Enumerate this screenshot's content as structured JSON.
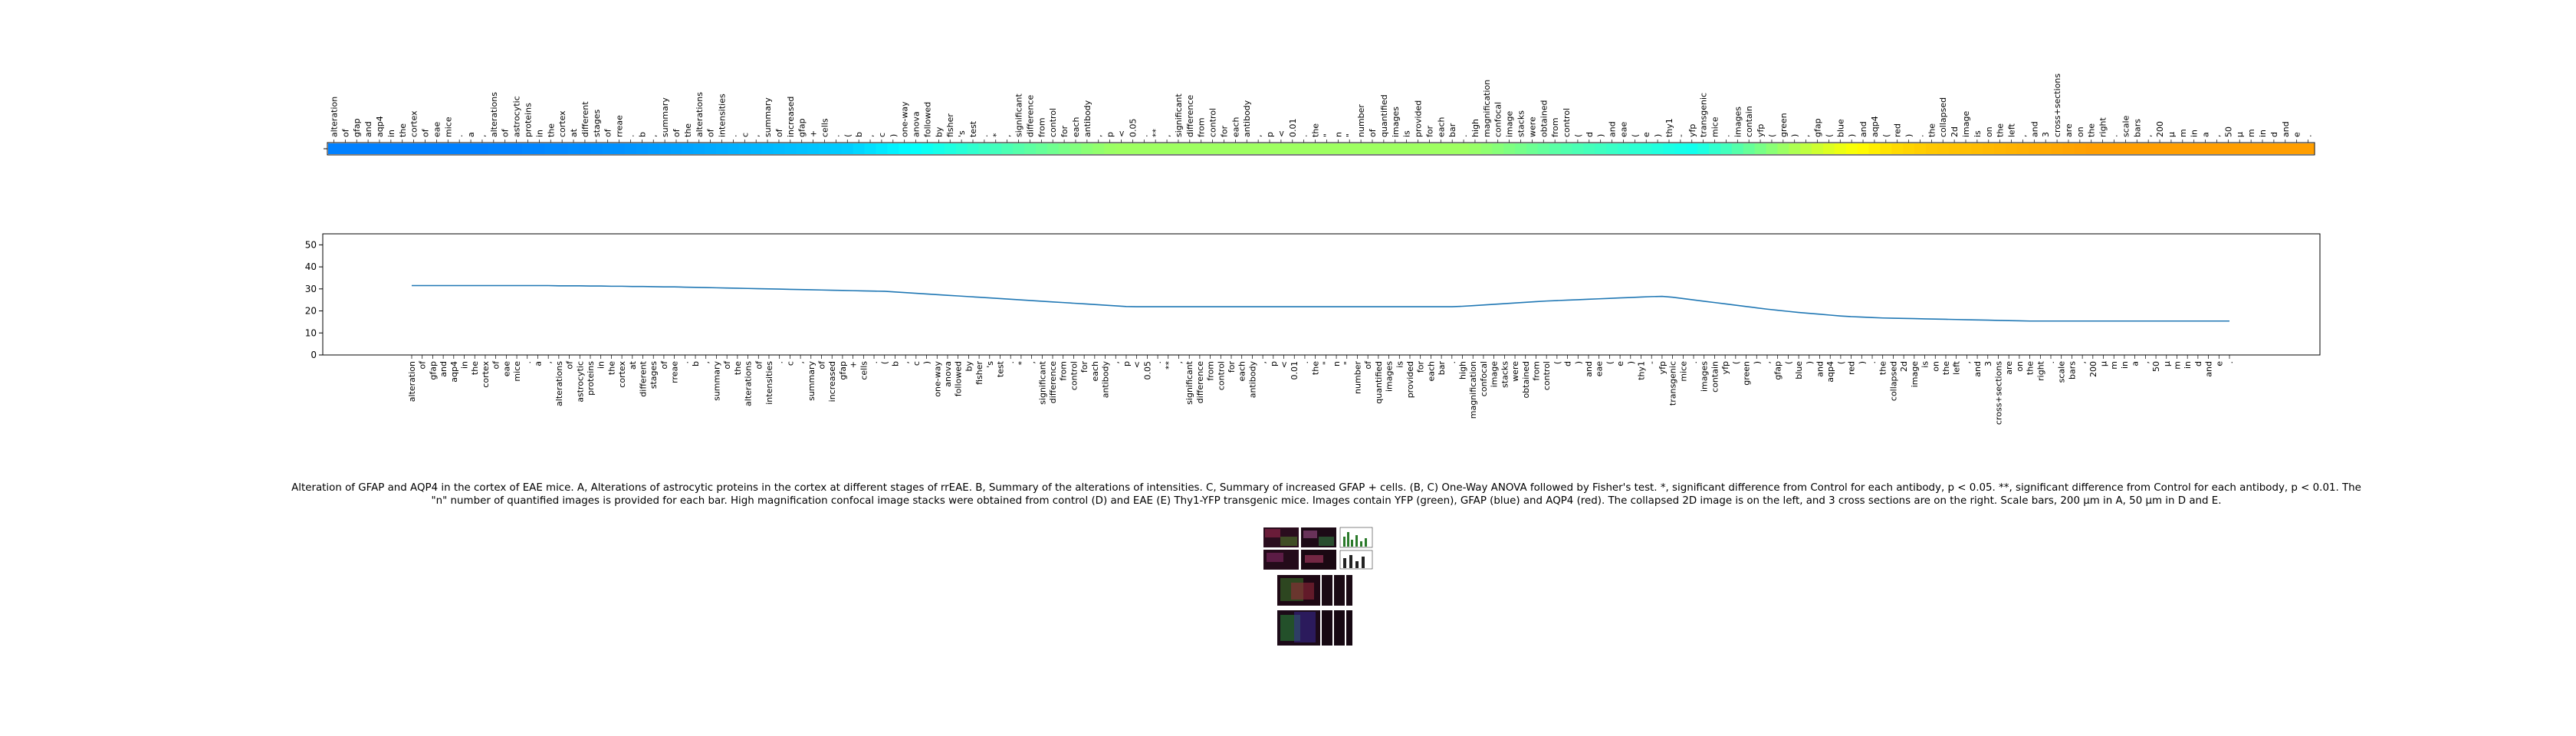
{
  "chart_data": [
    {
      "type": "heatmap",
      "tokens": [
        "alteration",
        "of",
        "gfap",
        "and",
        "aqp4",
        "in",
        "the",
        "cortex",
        "of",
        "eae",
        "mice",
        ".",
        "a",
        ",",
        "alterations",
        "of",
        "astrocytic",
        "proteins",
        "in",
        "the",
        "cortex",
        "at",
        "different",
        "stages",
        "of",
        "rreae",
        ".",
        "b",
        ",",
        "summary",
        "of",
        "the",
        "alterations",
        "of",
        "intensities",
        ".",
        "c",
        ",",
        "summary",
        "of",
        "increased",
        "gfap",
        "+",
        "cells",
        ".",
        "(",
        "b",
        ",",
        "c",
        ")",
        "one-way",
        "anova",
        "followed",
        "by",
        "fisher",
        "'s",
        "test",
        ".",
        "*",
        ",",
        "significant",
        "difference",
        "from",
        "control",
        "for",
        "each",
        "antibody",
        ",",
        "p",
        "<",
        "0.05",
        ".",
        "**",
        ",",
        "significant",
        "difference",
        "from",
        "control",
        "for",
        "each",
        "antibody",
        ",",
        "p",
        "<",
        "0.01",
        ".",
        "the",
        "\"",
        "n",
        "\"",
        "number",
        "of",
        "quantified",
        "images",
        "is",
        "provided",
        "for",
        "each",
        "bar",
        ".",
        "high",
        "magnification",
        "confocal",
        "image",
        "stacks",
        "were",
        "obtained",
        "from",
        "control",
        "(",
        "d",
        ")",
        "and",
        "eae",
        "(",
        "e",
        ")",
        "thy1",
        "-",
        "yfp",
        "transgenic",
        "mice",
        ".",
        "images",
        "contain",
        "yfp",
        "(",
        "green",
        ")",
        ",",
        "gfap",
        "(",
        "blue",
        ")",
        "and",
        "aqp4",
        "(",
        "red",
        ")",
        ".",
        "the",
        "collapsed",
        "2d",
        "image",
        "is",
        "on",
        "the",
        "left",
        ",",
        "and",
        "3",
        "cross+sections",
        "are",
        "on",
        "the",
        "right",
        ".",
        "scale",
        "bars",
        ",",
        "200",
        "μ",
        "m",
        "in",
        "a",
        ",",
        "50",
        "μ",
        "m",
        "in",
        "d",
        "and",
        "e",
        "."
      ],
      "colormap": "jet-like (yellow-green to cyan to blue)",
      "values": [
        31.5,
        31.5,
        31.5,
        31.5,
        31.5,
        31.5,
        31.5,
        31.5,
        31.5,
        31.5,
        31.5,
        31.5,
        31.5,
        31.5,
        31.4,
        31.4,
        31.4,
        31.3,
        31.3,
        31.2,
        31.2,
        31.1,
        31.1,
        31.0,
        30.9,
        30.9,
        30.8,
        30.7,
        30.6,
        30.5,
        30.4,
        30.3,
        30.2,
        30.1,
        30.0,
        29.9,
        29.8,
        29.7,
        29.6,
        29.5,
        29.4,
        29.3,
        29.2,
        29.1,
        29.0,
        28.9,
        28.6,
        28.3,
        28.0,
        27.7,
        27.4,
        27.1,
        26.8,
        26.5,
        26.2,
        25.9,
        25.6,
        25.3,
        25.0,
        24.7,
        24.4,
        24.1,
        23.8,
        23.5,
        23.2,
        22.9,
        22.6,
        22.3,
        22.0,
        21.9,
        21.9,
        21.9,
        21.9,
        21.9,
        21.9,
        21.9,
        21.9,
        21.9,
        21.9,
        21.9,
        21.9,
        21.9,
        21.9,
        21.9,
        21.9,
        21.9,
        21.9,
        21.9,
        21.9,
        21.9,
        21.9,
        21.9,
        21.9,
        21.9,
        21.9,
        21.9,
        21.9,
        21.9,
        21.9,
        21.9,
        22.1,
        22.4,
        22.7,
        23.0,
        23.3,
        23.6,
        23.9,
        24.2,
        24.5,
        24.7,
        24.9,
        25.1,
        25.3,
        25.5,
        25.7,
        25.9,
        26.1,
        26.3,
        26.5,
        26.6,
        26.2,
        25.6,
        25.0,
        24.4,
        23.8,
        23.2,
        22.6,
        22.0,
        21.4,
        20.8,
        20.3,
        19.8,
        19.3,
        18.9,
        18.5,
        18.1,
        17.7,
        17.4,
        17.2,
        17.0,
        16.8,
        16.7,
        16.6,
        16.5,
        16.4,
        16.3,
        16.2,
        16.1,
        16.0,
        15.9,
        15.8,
        15.7,
        15.6,
        15.5,
        15.4,
        15.4,
        15.4,
        15.4,
        15.4,
        15.4,
        15.4,
        15.4,
        15.4,
        15.4,
        15.4,
        15.4,
        15.4,
        15.4,
        15.4,
        15.4,
        15.4,
        15.4,
        15.4,
        15.4,
        15.4,
        15.4,
        15.4,
        15.4
      ]
    },
    {
      "type": "line",
      "x_tick_labels": [
        "alteration",
        "of",
        "gfap",
        "and",
        "aqp4",
        "in",
        "the",
        "cortex",
        "of",
        "eae",
        "mice",
        ".",
        "a",
        ",",
        "alterations",
        "of",
        "astrocytic",
        "proteins",
        "in",
        "the",
        "cortex",
        "at",
        "different",
        "stages",
        "of",
        "rreae",
        ".",
        "b",
        ",",
        "summary",
        "of",
        "the",
        "alterations",
        "of",
        "intensities",
        ".",
        "c",
        ",",
        "summary",
        "of",
        "increased",
        "gfap",
        "+",
        "cells",
        ".",
        "(",
        "b",
        ",",
        "c",
        ")",
        "one-way",
        "anova",
        "followed",
        "by",
        "fisher",
        "'s",
        "test",
        ".",
        "*",
        ",",
        "significant",
        "difference",
        "from",
        "control",
        "for",
        "each",
        "antibody",
        ",",
        "p",
        "<",
        "0.05",
        ".",
        "**",
        ",",
        "significant",
        "difference",
        "from",
        "control",
        "for",
        "each",
        "antibody",
        ",",
        "p",
        "<",
        "0.01",
        ".",
        "the",
        "\"",
        "n",
        "\"",
        "number",
        "of",
        "quantified",
        "images",
        "is",
        "provided",
        "for",
        "each",
        "bar",
        ".",
        "high",
        "magnification",
        "confocal",
        "image",
        "stacks",
        "were",
        "obtained",
        "from",
        "control",
        "(",
        "d",
        ")",
        "and",
        "eae",
        "(",
        "e",
        ")",
        "thy1",
        "-",
        "yfp",
        "transgenic",
        "mice",
        ".",
        "images",
        "contain",
        "yfp",
        "(",
        "green",
        ")",
        ",",
        "gfap",
        "(",
        "blue",
        ")",
        "and",
        "aqp4",
        "(",
        "red",
        ")",
        ".",
        "the",
        "collapsed",
        "2d",
        "image",
        "is",
        "on",
        "the",
        "left",
        ",",
        "and",
        "3",
        "cross+sections",
        "are",
        "on",
        "the",
        "right",
        ".",
        "scale",
        "bars",
        ",",
        "200",
        "μ",
        "m",
        "in",
        "a",
        ",",
        "50",
        "μ",
        "m",
        "in",
        "d",
        "and",
        "e",
        "."
      ],
      "y_ticks": [
        0,
        10,
        20,
        30,
        40,
        50
      ],
      "ylim": [
        0,
        55
      ],
      "series_color": "#1f77b4",
      "values_ref": "same as heatmap values"
    }
  ],
  "caption": "Alteration of GFAP and AQP4 in the cortex of EAE mice. A, Alterations of astrocytic proteins in the cortex at different stages of rrEAE. B, Summary of the alterations of intensities. C, Summary of increased GFAP + cells. (B, C) One-Way ANOVA followed by Fisher's test. *, significant difference from Control for each antibody, p < 0.05. **, significant difference from Control for each antibody, p < 0.01. The \"n\" number of quantified images is provided for each bar. High magnification confocal image stacks were obtained from control (D) and EAE (E) Thy1-YFP transgenic mice. Images contain YFP (green), GFAP (blue) and AQP4 (red). The collapsed 2D image is on the left, and 3 cross sections are on the right. Scale bars, 200 μm in A, 50 μm in D and E."
}
